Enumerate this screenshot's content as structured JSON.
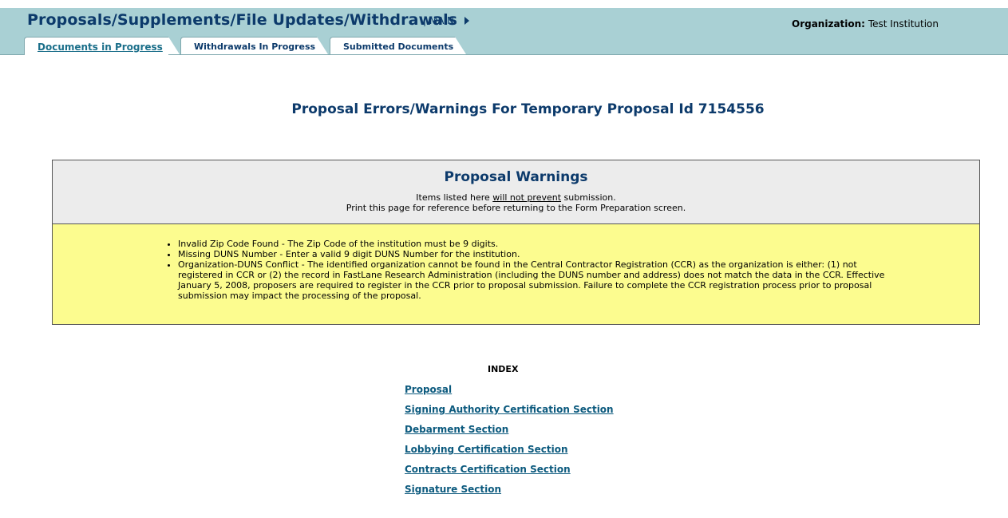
{
  "header": {
    "title": "Proposals/Supplements/File Updates/Withdrawals",
    "main_link": "| MAIN",
    "org_label": "Organization:",
    "org_value": "Test Institution"
  },
  "tabs": [
    {
      "label": "Documents in Progress",
      "active": true
    },
    {
      "label": "Withdrawals In Progress",
      "active": false
    },
    {
      "label": "Submitted Documents",
      "active": false
    }
  ],
  "page_title": "Proposal Errors/Warnings For Temporary Proposal Id 7154556",
  "warnings": {
    "heading": "Proposal Warnings",
    "line1_before": "Items listed here ",
    "line1_underlined": "will not prevent",
    "line1_after": " submission.",
    "line2": "Print this page for reference before returning to the Form Preparation screen.",
    "items": [
      "Invalid Zip Code Found - The Zip Code of the institution must be 9 digits.",
      "Missing DUNS Number - Enter a valid 9 digit DUNS Number for the institution.",
      "Organization-DUNS Conflict - The identified organization cannot be found in the Central Contractor Registration (CCR) as the organization is either: (1) not registered in CCR or (2) the record in FastLane Research Administration (including the DUNS number and address) does not match the data in the CCR. Effective January 5, 2008, proposers are required to register in the CCR prior to proposal submission. Failure to complete the CCR registration process prior to proposal submission may impact the processing of the proposal."
    ]
  },
  "index": {
    "title": "INDEX",
    "links": [
      "Proposal",
      "Signing Authority Certification Section",
      "Debarment Section",
      "Lobbying Certification Section",
      "Contracts Certification Section",
      "Signature Section"
    ]
  },
  "colors": {
    "header_bg": "#a9d0d4",
    "title_blue": "#0c3a6b",
    "link_blue": "#0c5a7e",
    "warning_head_bg": "#ececec",
    "warning_body_bg": "#fcfc8f"
  }
}
